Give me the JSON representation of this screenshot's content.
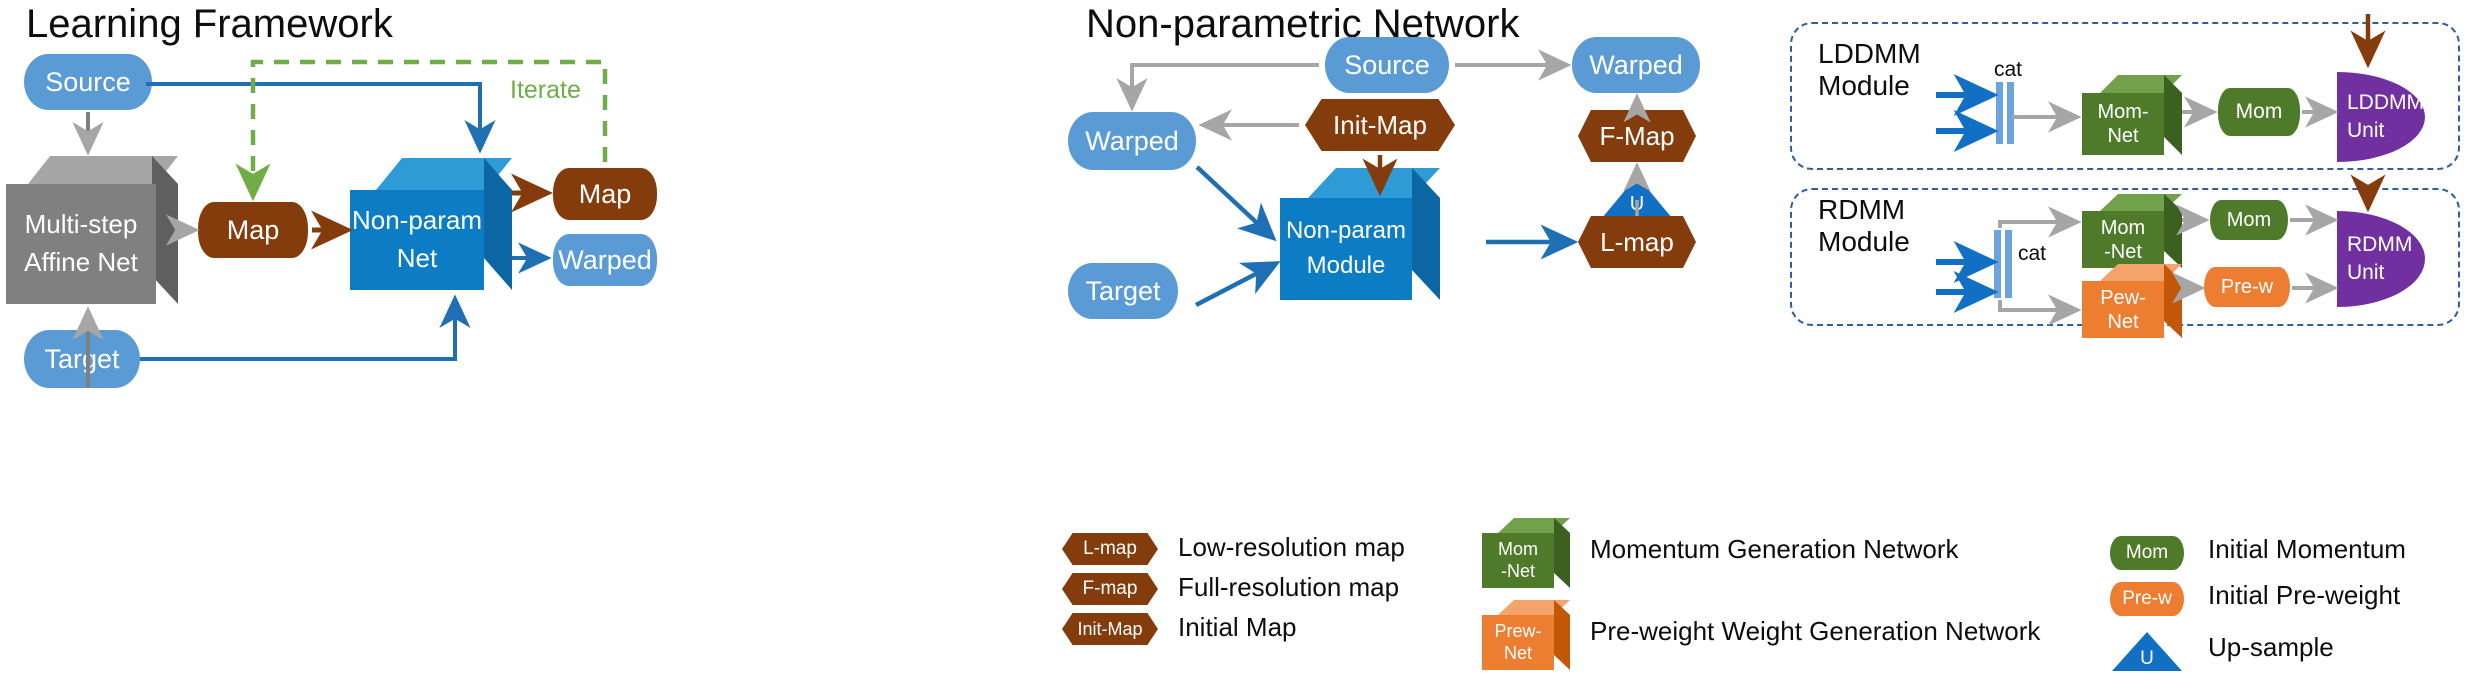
{
  "panels": {
    "learning": {
      "title": "Learning Framework",
      "nodes": {
        "source": "Source",
        "target": "Target",
        "affine_l1": "Multi-step",
        "affine_l2": "Affine Net",
        "map_mid": "Map",
        "nonparam_l1": "Non-param",
        "nonparam_l2": "Net",
        "map_out": "Map",
        "warped_out": "Warped"
      },
      "iterate_label": "Iterate"
    },
    "nonparam": {
      "title": "Non-parametric Network",
      "nodes": {
        "source": "Source",
        "warped_left": "Warped",
        "target": "Target",
        "init_map": "Init-Map",
        "module_l1": "Non-param",
        "module_l2": "Module",
        "l_map": "L-map",
        "upsample": "U",
        "f_map": "F-Map",
        "warped_right": "Warped"
      }
    },
    "lddmm": {
      "title": "LDDMM Module",
      "cat": "cat",
      "mom_net_l1": "Mom-",
      "mom_net_l2": "Net",
      "mom": "Mom",
      "unit_l1": "LDDMM",
      "unit_l2": "Unit"
    },
    "rdmm": {
      "title": "RDMM Module",
      "cat": "cat",
      "mom_net_l1": "Mom",
      "mom_net_l2": "-Net",
      "mom": "Mom",
      "pew_net_l1": "Pew-",
      "pew_net_l2": "Net",
      "pre_w": "Pre-w",
      "unit_l1": "RDMM",
      "unit_l2": "Unit"
    }
  },
  "legend": {
    "col1": [
      {
        "chip": "L-map",
        "text": "Low-resolution map"
      },
      {
        "chip": "F-map",
        "text": "Full-resolution map"
      },
      {
        "chip": "Init-Map",
        "text": "Initial Map"
      }
    ],
    "col2": [
      {
        "chip_l1": "Mom",
        "chip_l2": "-Net",
        "text": "Momentum Generation Network"
      },
      {
        "chip_l1": "Prew-",
        "chip_l2": "Net",
        "text": "Pre-weight Weight Generation Network"
      }
    ],
    "col3": [
      {
        "chip": "Mom",
        "text": "Initial Momentum"
      },
      {
        "chip": "Pre-w",
        "text": "Initial Pre-weight"
      },
      {
        "chip": "U",
        "text": "Up-sample"
      }
    ]
  },
  "colors": {
    "blue_node": "#5b9bd5",
    "brown_node": "#843c0c",
    "gray_cube": "#808080",
    "blue_cube": "#0c7cc4",
    "green_cube": "#4e7a29",
    "orange_cube": "#ed7d31",
    "purple_unit": "#7030a0",
    "green_dash": "#70ad47",
    "blue_arrow": "#1f6fb5",
    "gray_arrow": "#a6a6a6",
    "brown_arrow": "#843c0c",
    "frame_border": "#2e5fa3"
  }
}
